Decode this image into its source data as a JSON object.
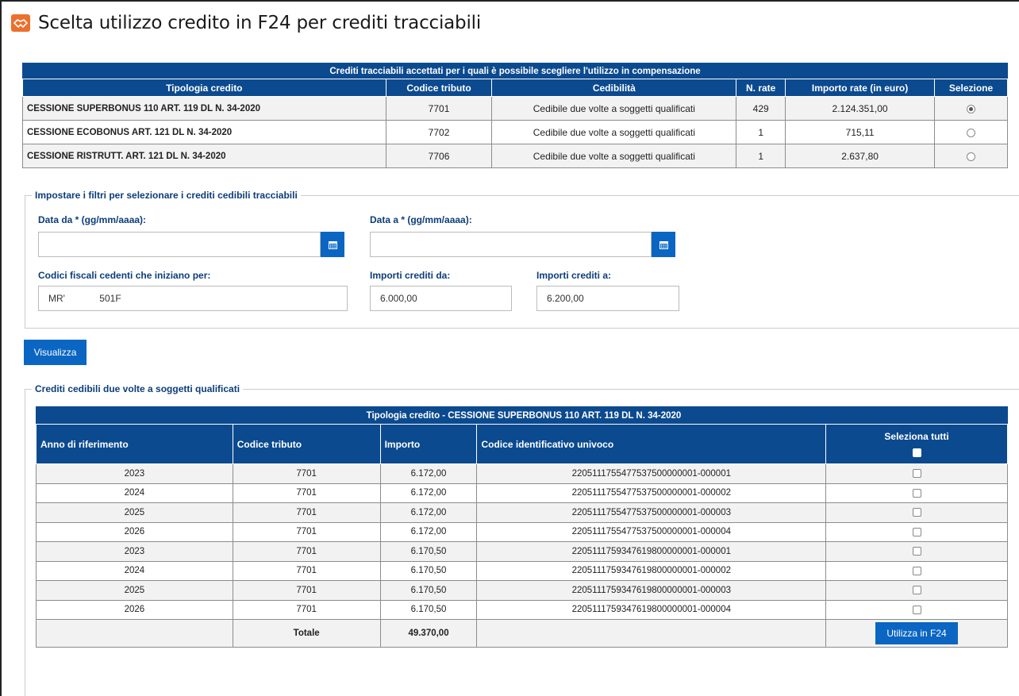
{
  "page": {
    "title": "Scelta utilizzo credito in F24 per crediti tracciabili"
  },
  "colors": {
    "primary": "#0c4a8f",
    "button": "#0a66c2",
    "logo": "#ec6f2d",
    "label": "#0c3d7a"
  },
  "table1": {
    "caption": "Crediti tracciabili accettati per i quali è possibile scegliere l'utilizzo in compensazione",
    "headers": [
      "Tipologia credito",
      "Codice tributo",
      "Cedibilità",
      "N. rate",
      "Importo rate (in euro)",
      "Selezione"
    ],
    "rows": [
      {
        "tipologia": "CESSIONE SUPERBONUS 110 ART. 119 DL N. 34-2020",
        "codice": "7701",
        "cedibilita": "Cedibile due volte a soggetti qualificati",
        "rate": "429",
        "importo": "2.124.351,00",
        "selected": true
      },
      {
        "tipologia": "CESSIONE ECOBONUS ART. 121 DL N. 34-2020",
        "codice": "7702",
        "cedibilita": "Cedibile due volte a soggetti qualificati",
        "rate": "1",
        "importo": "715,11",
        "selected": false
      },
      {
        "tipologia": "CESSIONE RISTRUTT. ART. 121 DL N. 34-2020",
        "codice": "7706",
        "cedibilita": "Cedibile due volte a soggetti qualificati",
        "rate": "1",
        "importo": "2.637,80",
        "selected": false
      }
    ]
  },
  "filters": {
    "legend": "Impostare i filtri per selezionare i crediti cedibili tracciabili",
    "data_da_label": "Data da * (gg/mm/aaaa):",
    "data_da_value": "",
    "data_a_label": "Data a * (gg/mm/aaaa):",
    "data_a_value": "",
    "cf_label": "Codici fiscali cedenti che iniziano per:",
    "cf_value": "MR'             501F",
    "importi_da_label": "Importi crediti da:",
    "importi_da_value": "6.000,00",
    "importi_a_label": "Importi crediti a:",
    "importi_a_value": "6.200,00",
    "calendar_icon": "calendar-icon"
  },
  "visualizza_label": "Visualizza",
  "table2": {
    "legend": "Crediti cedibili due volte a soggetti qualificati",
    "caption": "Tipologia credito - CESSIONE SUPERBONUS 110 ART. 119 DL N. 34-2020",
    "headers": [
      "Anno di riferimento",
      "Codice tributo",
      "Importo",
      "Codice identificativo univoco",
      "Seleziona tutti"
    ],
    "rows": [
      {
        "anno": "2023",
        "codice": "7701",
        "importo": "6.172,00",
        "id": "2205111755477537500000001-000001"
      },
      {
        "anno": "2024",
        "codice": "7701",
        "importo": "6.172,00",
        "id": "2205111755477537500000001-000002"
      },
      {
        "anno": "2025",
        "codice": "7701",
        "importo": "6.172,00",
        "id": "2205111755477537500000001-000003"
      },
      {
        "anno": "2026",
        "codice": "7701",
        "importo": "6.172,00",
        "id": "2205111755477537500000001-000004"
      },
      {
        "anno": "2023",
        "codice": "7701",
        "importo": "6.170,50",
        "id": "2205111759347619800000001-000001"
      },
      {
        "anno": "2024",
        "codice": "7701",
        "importo": "6.170,50",
        "id": "2205111759347619800000001-000002"
      },
      {
        "anno": "2025",
        "codice": "7701",
        "importo": "6.170,50",
        "id": "2205111759347619800000001-000003"
      },
      {
        "anno": "2026",
        "codice": "7701",
        "importo": "6.170,50",
        "id": "2205111759347619800000001-000004"
      }
    ],
    "totale_label": "Totale",
    "totale_value": "49.370,00",
    "utilizza_label": "Utilizza in F24"
  }
}
